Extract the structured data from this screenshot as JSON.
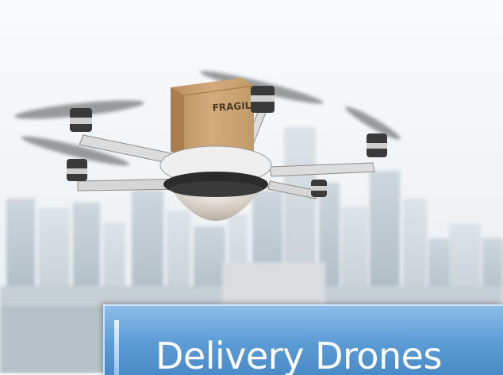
{
  "photo": {
    "package_label": "FRAGILE",
    "colors": {
      "sky": "#f2f4f6",
      "buildings": "#b8c4cc",
      "package": "#c9a272",
      "drone_body": "#e6e6e6"
    }
  },
  "caption": {
    "title": "Delivery Drones",
    "colors": {
      "box": "#5b9bd5",
      "text": "#ffffff"
    }
  }
}
